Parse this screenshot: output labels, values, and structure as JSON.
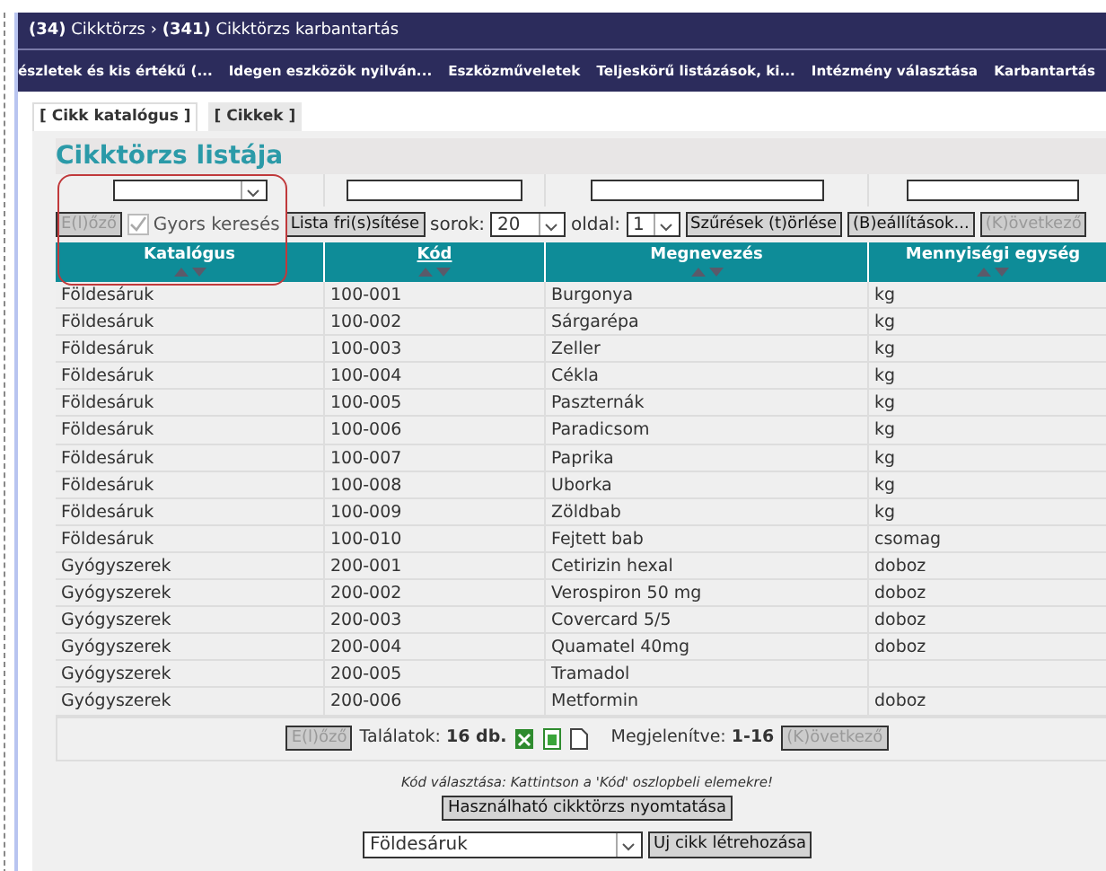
{
  "breadcrumb": [
    "**(34)** Cikktörzs",
    "›",
    "**(341)** Cikktörzs karbantartás"
  ],
  "menu": [
    "észletek és kis értékű (...",
    "Idegen eszközök nyilván...",
    "Eszközműveletek",
    "Teljeskörű listázások, ki...",
    "Intézmény választása",
    "Karbantartás"
  ],
  "tabs": [
    {
      "label": "[ Cikk katalógus ]",
      "selected": true
    },
    {
      "label": "[ Cikkek ]",
      "selected": false
    }
  ],
  "title": "Cikktörzs listája",
  "filters": [
    {
      "kind": "select"
    },
    {
      "kind": "text"
    },
    {
      "kind": "text"
    },
    {
      "kind": "text"
    }
  ],
  "toolbar": {
    "prev": {
      "label": "E(l)őző",
      "disabled": true
    },
    "quick_search": {
      "label": "Gyors keresés",
      "checked": true,
      "disabled": true
    },
    "refresh": "Lista fri(s)sítése",
    "rows_label": "sorok:",
    "rows_value": "20",
    "page_label": "oldal:",
    "page_value": "1",
    "clear": "Szűrések (t)örlése",
    "settings": "(B)eállítások...",
    "next": {
      "label": "(K)övetkező",
      "disabled": true
    }
  },
  "columns": [
    {
      "label": "Katalógus",
      "link": false
    },
    {
      "label": "Kód",
      "link": true
    },
    {
      "label": "Megnevezés",
      "link": false
    },
    {
      "label": "Mennyiségi egység",
      "link": false
    }
  ],
  "rows": [
    [
      "Földesáruk",
      "100-001",
      "Burgonya",
      "kg"
    ],
    [
      "Földesáruk",
      "100-002",
      "Sárgarépa",
      "kg"
    ],
    [
      "Földesáruk",
      "100-003",
      "Zeller",
      "kg"
    ],
    [
      "Földesáruk",
      "100-004",
      "Cékla",
      "kg"
    ],
    [
      "Földesáruk",
      "100-005",
      "Paszternák",
      "kg"
    ],
    [
      "Földesáruk",
      "100-006",
      "Paradicsom",
      "kg"
    ],
    [
      "Földesáruk",
      "100-007",
      "Paprika",
      "kg"
    ],
    [
      "Földesáruk",
      "100-008",
      "Uborka",
      "kg"
    ],
    [
      "Földesáruk",
      "100-009",
      "Zöldbab",
      "kg"
    ],
    [
      "Földesáruk",
      "100-010",
      "Fejtett bab",
      "csomag"
    ],
    [
      "Gyógyszerek",
      "200-001",
      "Cetirizin hexal",
      "doboz"
    ],
    [
      "Gyógyszerek",
      "200-002",
      "Verospiron 50 mg",
      "doboz"
    ],
    [
      "Gyógyszerek",
      "200-003",
      "Covercard 5/5",
      "doboz"
    ],
    [
      "Gyógyszerek",
      "200-004",
      "Quamatel 40mg",
      "doboz"
    ],
    [
      "Gyógyszerek",
      "200-005",
      "Tramadol",
      ""
    ],
    [
      "Gyógyszerek",
      "200-006",
      "Metformin",
      "doboz"
    ]
  ],
  "footer": {
    "prev": {
      "label": "E(l)őző",
      "disabled": true
    },
    "results": "Találatok: **16 db.**",
    "shown": "Megjelenítve: **1-16**",
    "next": {
      "label": "(K)övetkező",
      "disabled": true
    }
  },
  "hint": "Kód választása: Kattintson a 'Kód' oszlopbeli elemekre!",
  "print_button": "Használható cikktörzs nyomtatása",
  "catalog_select": "Földesáruk",
  "create_button": "Uj cikk létrehozása"
}
